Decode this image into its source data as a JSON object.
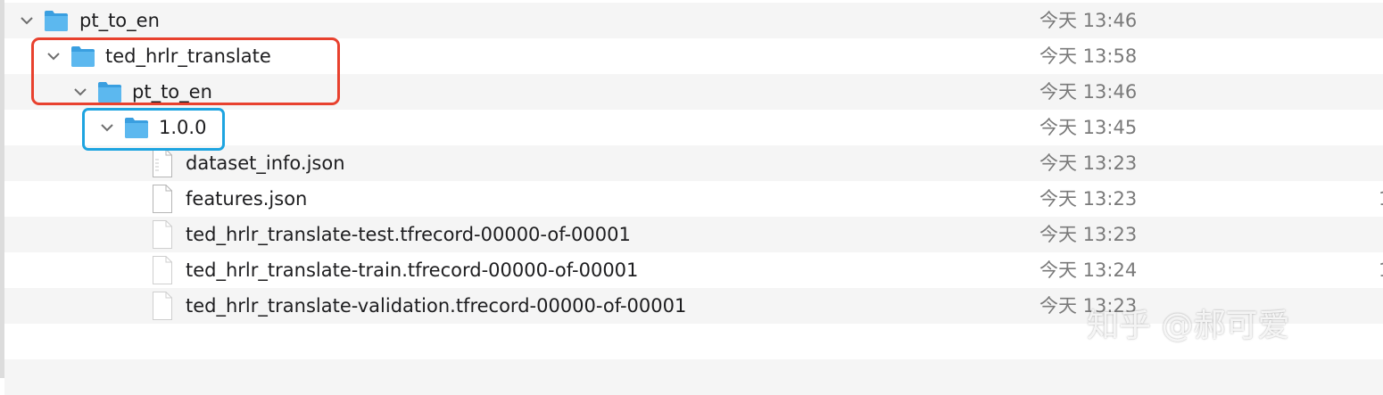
{
  "rows": [
    {
      "name": "pt_to_en",
      "date": "今天 13:46",
      "type": "folder",
      "expanded": true,
      "level": 0
    },
    {
      "name": "ted_hrlr_translate",
      "date": "今天 13:58",
      "type": "folder",
      "expanded": true,
      "level": 1
    },
    {
      "name": "pt_to_en",
      "date": "今天 13:46",
      "type": "folder",
      "expanded": true,
      "level": 2
    },
    {
      "name": "1.0.0",
      "date": "今天 13:45",
      "type": "folder",
      "expanded": true,
      "level": 3
    },
    {
      "name": "dataset_info.json",
      "date": "今天 13:23",
      "type": "file",
      "level": 4
    },
    {
      "name": "features.json",
      "date": "今天 13:23",
      "type": "file",
      "level": 4,
      "clipped": "1"
    },
    {
      "name": "ted_hrlr_translate-test.tfrecord-00000-of-00001",
      "date": "今天 13:23",
      "type": "file",
      "level": 4
    },
    {
      "name": "ted_hrlr_translate-train.tfrecord-00000-of-00001",
      "date": "今天 13:24",
      "type": "file",
      "level": 4,
      "clipped": "1"
    },
    {
      "name": "ted_hrlr_translate-validation.tfrecord-00000-of-00001",
      "date": "今天 13:23",
      "type": "file",
      "level": 4
    }
  ],
  "watermark": "知乎 @郝可爱",
  "colors": {
    "folder": "#5cb8ef",
    "folder_dark": "#3a9fe0",
    "highlight_red": "#e8412e",
    "highlight_blue": "#1ea4e0",
    "date": "#7a7a7a",
    "row_alt": "#f5f5f5"
  }
}
